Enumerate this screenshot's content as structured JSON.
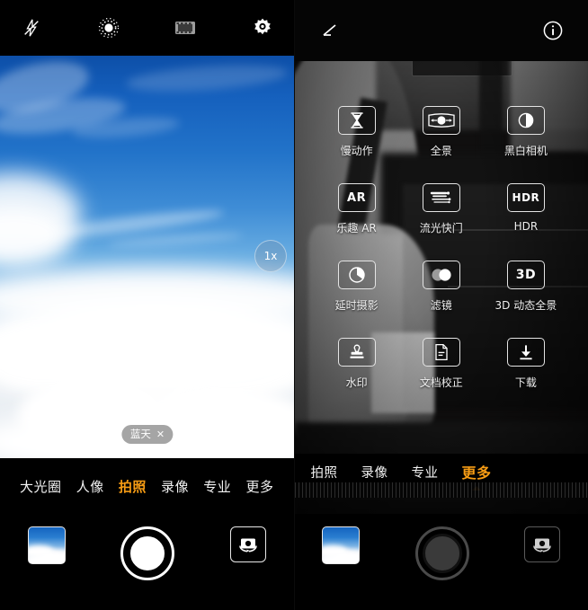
{
  "left_panel": {
    "topbar": [
      {
        "name": "flash-off-icon",
        "label": "flash-off"
      },
      {
        "name": "ai-master-icon",
        "label": "ai-master"
      },
      {
        "name": "film-strip-icon",
        "label": "moving-picture"
      },
      {
        "name": "settings-gear-icon",
        "label": "settings"
      }
    ],
    "zoom_label": "1x",
    "scene_badge": {
      "text": "蓝天",
      "close": "✕"
    },
    "modes": [
      {
        "label": "大光圈",
        "active": false
      },
      {
        "label": "人像",
        "active": false
      },
      {
        "label": "拍照",
        "active": true
      },
      {
        "label": "录像",
        "active": false
      },
      {
        "label": "专业",
        "active": false
      },
      {
        "label": "更多",
        "active": false
      }
    ],
    "bottom": {
      "gallery": "gallery-thumbnail",
      "shutter": "shutter-button",
      "flip": "camera-flip-button"
    }
  },
  "right_panel": {
    "topbar": [
      {
        "name": "edit-pencil-icon",
        "label": "edit"
      },
      {
        "name": "info-circle-icon",
        "label": "info"
      }
    ],
    "grid": [
      {
        "label": "慢动作",
        "icon": "hourglass-icon",
        "text": ""
      },
      {
        "label": "全景",
        "icon": "panorama-icon",
        "text": ""
      },
      {
        "label": "黑白相机",
        "icon": "monochrome-icon",
        "text": ""
      },
      {
        "label": "乐趣 AR",
        "icon": "ar-icon",
        "text": "AR"
      },
      {
        "label": "流光快门",
        "icon": "light-painting-icon",
        "text": ""
      },
      {
        "label": "HDR",
        "icon": "hdr-icon",
        "text": "HDR"
      },
      {
        "label": "延时摄影",
        "icon": "time-lapse-icon",
        "text": ""
      },
      {
        "label": "滤镜",
        "icon": "filter-icon",
        "text": ""
      },
      {
        "label": "3D 动态全景",
        "icon": "3d-panorama-icon",
        "text": "3D"
      },
      {
        "label": "水印",
        "icon": "watermark-stamp-icon",
        "text": ""
      },
      {
        "label": "文档校正",
        "icon": "document-scan-icon",
        "text": ""
      },
      {
        "label": "下载",
        "icon": "download-icon",
        "text": ""
      }
    ],
    "modes": [
      {
        "label": "拍照",
        "active": false
      },
      {
        "label": "录像",
        "active": false
      },
      {
        "label": "专业",
        "active": false
      },
      {
        "label": "更多",
        "active": true
      }
    ],
    "bottom": {
      "gallery": "gallery-thumbnail",
      "shutter": "shutter-button",
      "flip": "camera-flip-button"
    }
  },
  "colors": {
    "accent": "#f59b14",
    "text": "#f2f2f2",
    "background": "#000000"
  }
}
